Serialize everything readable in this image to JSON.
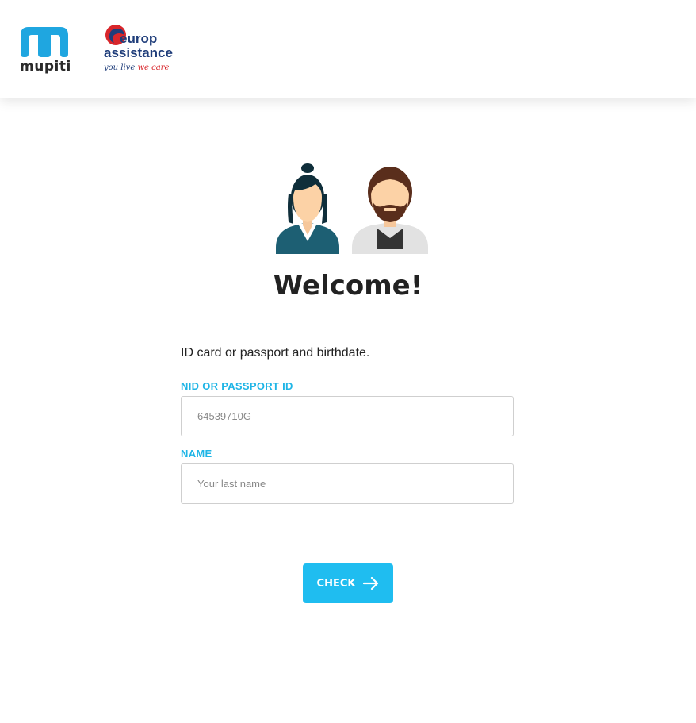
{
  "header": {
    "brand_left": "mupiti",
    "brand_right_line1": "europ",
    "brand_right_line2": "assistance",
    "brand_right_tagline_part1": "you live",
    "brand_right_tagline_part2": "we care",
    "colors": {
      "mupiti_blue": "#1fa6e0",
      "europ_navy": "#1f3d7a",
      "europ_red": "#d8262b"
    }
  },
  "main": {
    "title": "Welcome!",
    "instruction": "ID card or passport and birthdate.",
    "fields": {
      "nid": {
        "label": "NID OR PASSPORT ID",
        "value": "",
        "placeholder": "64539710G"
      },
      "name": {
        "label": "NAME",
        "value": "",
        "placeholder": "Your last name"
      }
    },
    "check_button": {
      "label": "CHECK",
      "icon": "arrow-right-icon"
    },
    "colors": {
      "accent": "#1fbdf0",
      "label": "#1fb5e6"
    }
  }
}
